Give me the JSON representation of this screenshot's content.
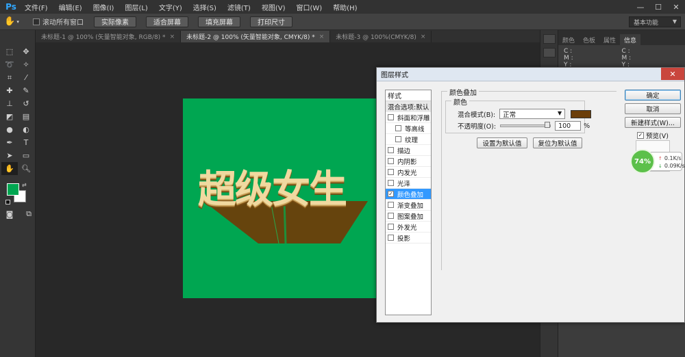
{
  "app": {
    "logo": "Ps"
  },
  "menu": [
    "文件(F)",
    "编辑(E)",
    "图像(I)",
    "图层(L)",
    "文字(Y)",
    "选择(S)",
    "滤镜(T)",
    "视图(V)",
    "窗口(W)",
    "帮助(H)"
  ],
  "window_controls": {
    "minimize": "—",
    "restore": "☐",
    "close": "✕"
  },
  "options_bar": {
    "scroll_all_label": "滚动所有窗口",
    "buttons": [
      "实际像素",
      "适合屏幕",
      "填充屏幕",
      "打印尺寸"
    ],
    "workspace": "基本功能"
  },
  "tabs": [
    {
      "label": "未标题-1 @ 100% (矢量智能对象, RGB/8) *",
      "close": "×"
    },
    {
      "label": "未标题-2 @ 100% (矢量智能对象, CMYK/8) *",
      "close": "×"
    },
    {
      "label": "未标题-3 @ 100%(CMYK/8)",
      "close": "×"
    }
  ],
  "canvas": {
    "text": "超级女生",
    "background_color": "#00a651",
    "text_color": "#f0d9a0"
  },
  "right_panel": {
    "tabs": [
      "颜色",
      "色板",
      "属性",
      "信息"
    ],
    "info_left": [
      "C :",
      "M :",
      "Y :"
    ],
    "info_right": [
      "C :",
      "M :",
      "Y :"
    ]
  },
  "dialog": {
    "title": "图层样式",
    "close": "✕",
    "styles_header": "样式",
    "blend_options": "混合选项:默认",
    "style_items": [
      {
        "label": "斜面和浮雕",
        "checked": false,
        "sub": false
      },
      {
        "label": "等高线",
        "checked": false,
        "sub": true
      },
      {
        "label": "纹理",
        "checked": false,
        "sub": true
      },
      {
        "label": "描边",
        "checked": false,
        "sub": false
      },
      {
        "label": "内阴影",
        "checked": false,
        "sub": false
      },
      {
        "label": "内发光",
        "checked": false,
        "sub": false
      },
      {
        "label": "光泽",
        "checked": false,
        "sub": false
      },
      {
        "label": "颜色叠加",
        "checked": true,
        "sub": false,
        "selected": true
      },
      {
        "label": "渐变叠加",
        "checked": false,
        "sub": false
      },
      {
        "label": "图案叠加",
        "checked": false,
        "sub": false
      },
      {
        "label": "外发光",
        "checked": false,
        "sub": false
      },
      {
        "label": "投影",
        "checked": false,
        "sub": false
      }
    ],
    "section_title": "颜色叠加",
    "group_title": "颜色",
    "blend_mode_label": "混合模式(B):",
    "blend_mode_value": "正常",
    "overlay_color": "#6b3e0a",
    "opacity_label": "不透明度(O):",
    "opacity_value": "100",
    "opacity_unit": "%",
    "opacity_fraction": 1.0,
    "set_default": "设置为默认值",
    "reset_default": "复位为默认值",
    "ok": "确定",
    "cancel": "取消",
    "new_style": "新建样式(W)...",
    "preview_label": "预览(V)",
    "preview_checked": true
  },
  "net_widget": {
    "percent": "74%",
    "up": "0.1K/s",
    "down": "0.09K/s",
    "up_arrow": "↑",
    "down_arrow": "↓"
  }
}
